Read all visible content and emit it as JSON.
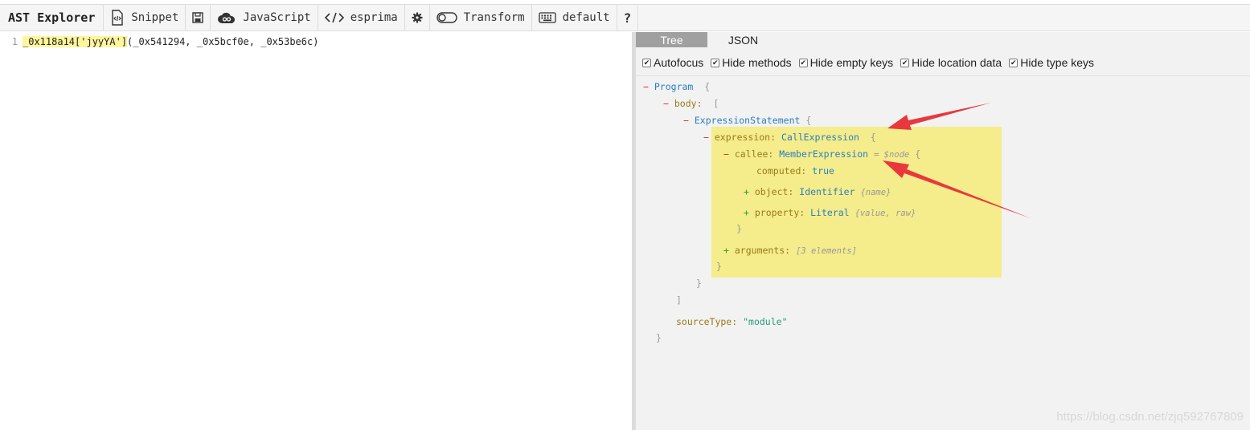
{
  "toolbar": {
    "title": "AST Explorer",
    "items": [
      {
        "label": "Snippet",
        "icon": "snippet-icon"
      },
      {
        "label": "",
        "icon": "save-icon"
      },
      {
        "label": "JavaScript",
        "icon": "cloud-icon"
      },
      {
        "label": "esprima",
        "icon": "code-icon"
      },
      {
        "label": "",
        "icon": "gear-icon"
      },
      {
        "label": "Transform",
        "icon": "toggle-icon"
      },
      {
        "label": "default",
        "icon": "keyboard-icon"
      },
      {
        "label": "?",
        "icon": "help-icon"
      }
    ]
  },
  "editor": {
    "line_number": "1",
    "code_highlight": "_0x118a14['jyyYA']",
    "code_rest": "(_0x541294, _0x5bcf0e, _0x53be6c)"
  },
  "panel": {
    "tabs": [
      {
        "label": "Tree",
        "active": true
      },
      {
        "label": "JSON",
        "active": false
      }
    ],
    "options": [
      {
        "label": "Autofocus",
        "checked": true
      },
      {
        "label": "Hide methods",
        "checked": true
      },
      {
        "label": "Hide empty keys",
        "checked": true
      },
      {
        "label": "Hide location data",
        "checked": true
      },
      {
        "label": "Hide type keys",
        "checked": true
      }
    ]
  },
  "tree": {
    "program": "Program",
    "body_key": "body:",
    "expression_statement": "ExpressionStatement",
    "expression_key": "expression:",
    "call_expression": "CallExpression",
    "callee_key": "callee:",
    "member_expression": "MemberExpression",
    "node_meta": "= $node",
    "computed_key": "computed:",
    "computed_val": "true",
    "object_key": "object:",
    "identifier": "Identifier",
    "identifier_meta": "{name}",
    "property_key": "property:",
    "literal": "Literal",
    "literal_meta": "{value, raw}",
    "arguments_key": "arguments:",
    "arguments_meta": "[3 elements]",
    "source_type_key": "sourceType:",
    "source_type_val": "\"module\""
  },
  "watermark": "https://blog.csdn.net/zjq592767809",
  "colors": {
    "highlight": "#f5ec8b",
    "arrow": "#e8383d",
    "tab_active": "#a0a0a0"
  }
}
